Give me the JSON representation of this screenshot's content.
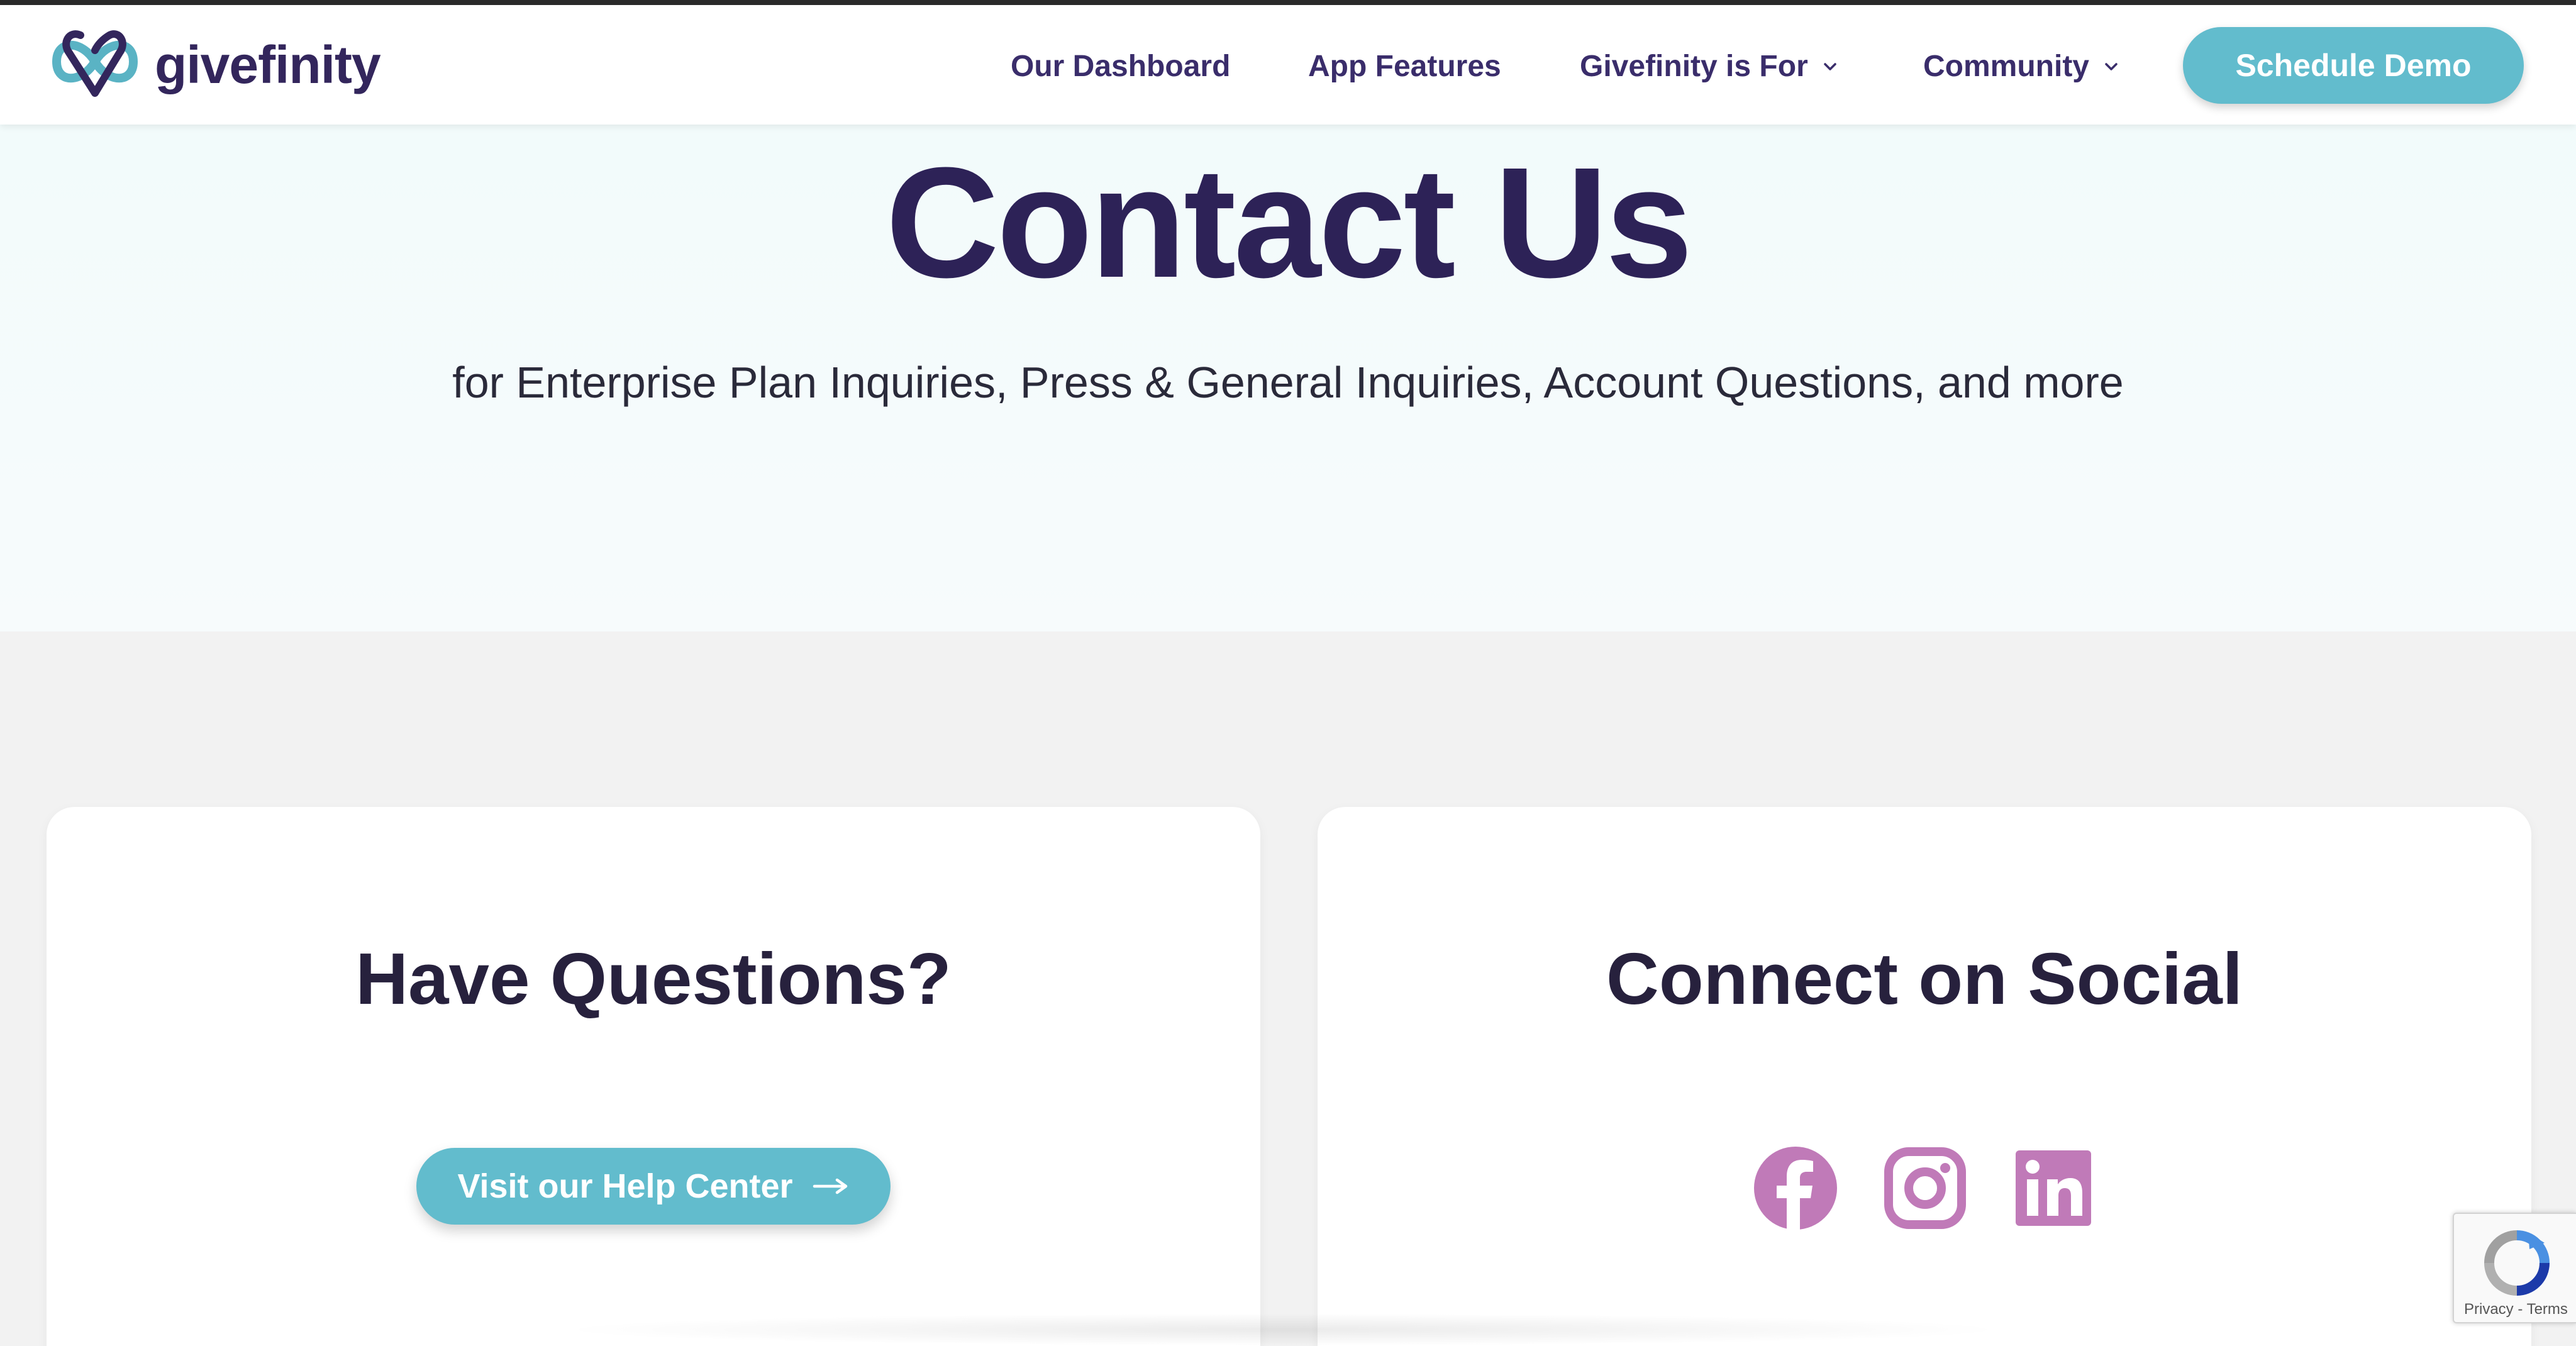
{
  "header": {
    "logo_text": "givefinity",
    "nav": {
      "dashboard": "Our Dashboard",
      "features": "App Features",
      "for": "Givefinity is For",
      "community": "Community"
    },
    "demo_button": "Schedule Demo"
  },
  "hero": {
    "title": "Contact Us",
    "subtitle": "for Enterprise Plan Inquiries, Press & General Inquiries, Account Questions, and more"
  },
  "cards": {
    "questions": {
      "title": "Have Questions?",
      "button": "Visit our Help Center"
    },
    "social": {
      "title": "Connect on Social",
      "icons": [
        "facebook-icon",
        "instagram-icon",
        "linkedin-icon"
      ]
    }
  },
  "recaptcha": {
    "links": "Privacy - Terms"
  },
  "colors": {
    "brand_dark": "#2d2257",
    "accent_teal": "#62bccd",
    "social_pink": "#c07ab8"
  }
}
